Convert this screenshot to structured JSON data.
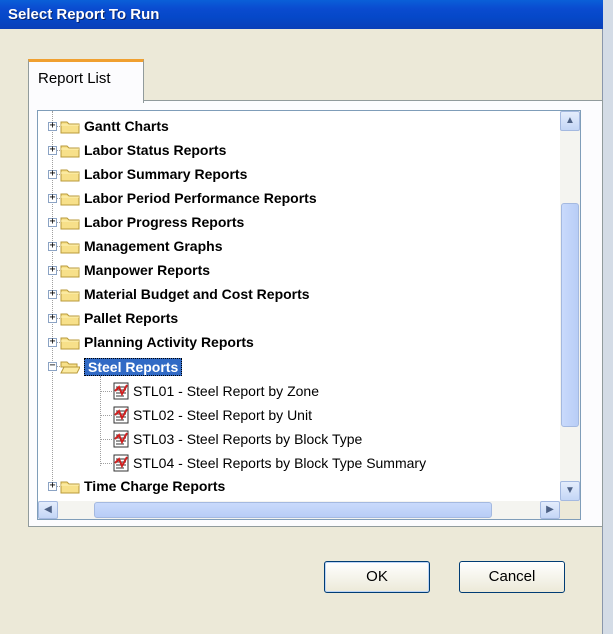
{
  "window": {
    "title": "Select Report To Run"
  },
  "tabs": [
    {
      "label": "Report List",
      "active": true
    }
  ],
  "tree": {
    "folders_before": [
      {
        "label": "Gantt Charts"
      },
      {
        "label": "Labor  Status Reports"
      },
      {
        "label": "Labor  Summary Reports"
      },
      {
        "label": "Labor Period Performance Reports"
      },
      {
        "label": "Labor Progress Reports"
      },
      {
        "label": "Management Graphs"
      },
      {
        "label": "Manpower Reports"
      },
      {
        "label": "Material Budget and Cost Reports"
      },
      {
        "label": "Pallet Reports"
      },
      {
        "label": "Planning Activity Reports"
      }
    ],
    "expanded_folder": {
      "label": "Steel Reports",
      "selected": true,
      "children": [
        {
          "label": "STL01 - Steel Report by Zone"
        },
        {
          "label": "STL02 - Steel Report by Unit"
        },
        {
          "label": "STL03 - Steel Reports by Block Type"
        },
        {
          "label": "STL04 - Steel Reports by Block Type Summary"
        }
      ]
    },
    "folders_after": [
      {
        "label": "Time Charge Reports"
      }
    ]
  },
  "buttons": {
    "ok": "OK",
    "cancel": "Cancel"
  },
  "colors": {
    "title_bar": "#0a4bd0",
    "selection": "#316ac5",
    "tab_accent": "#f0a030"
  }
}
